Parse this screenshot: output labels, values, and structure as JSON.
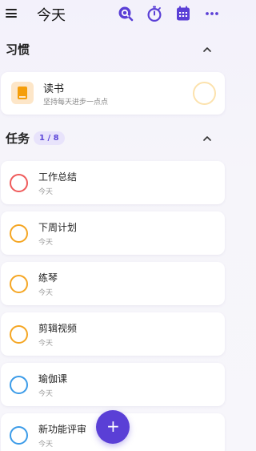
{
  "header": {
    "title": "今天"
  },
  "colors": {
    "accent": "#5a3fd6",
    "red": "#ef5a5a",
    "orange": "#f5a623",
    "blue": "#3b9be8"
  },
  "habits": {
    "title": "习惯",
    "items": [
      {
        "name": "读书",
        "subtitle": "坚持每天进步一点点"
      }
    ]
  },
  "tasks": {
    "title": "任务",
    "count": "1 / 8",
    "items": [
      {
        "title": "工作总结",
        "date": "今天",
        "color": "#ef5a5a"
      },
      {
        "title": "下周计划",
        "date": "今天",
        "color": "#f5a623"
      },
      {
        "title": "练琴",
        "date": "今天",
        "color": "#f5a623"
      },
      {
        "title": "剪辑视频",
        "date": "今天",
        "color": "#f5a623"
      },
      {
        "title": "瑜伽课",
        "date": "今天",
        "color": "#3b9be8"
      },
      {
        "title": "新功能评审",
        "date": "今天",
        "color": "#3b9be8"
      }
    ]
  },
  "fab": {
    "label": "+"
  }
}
